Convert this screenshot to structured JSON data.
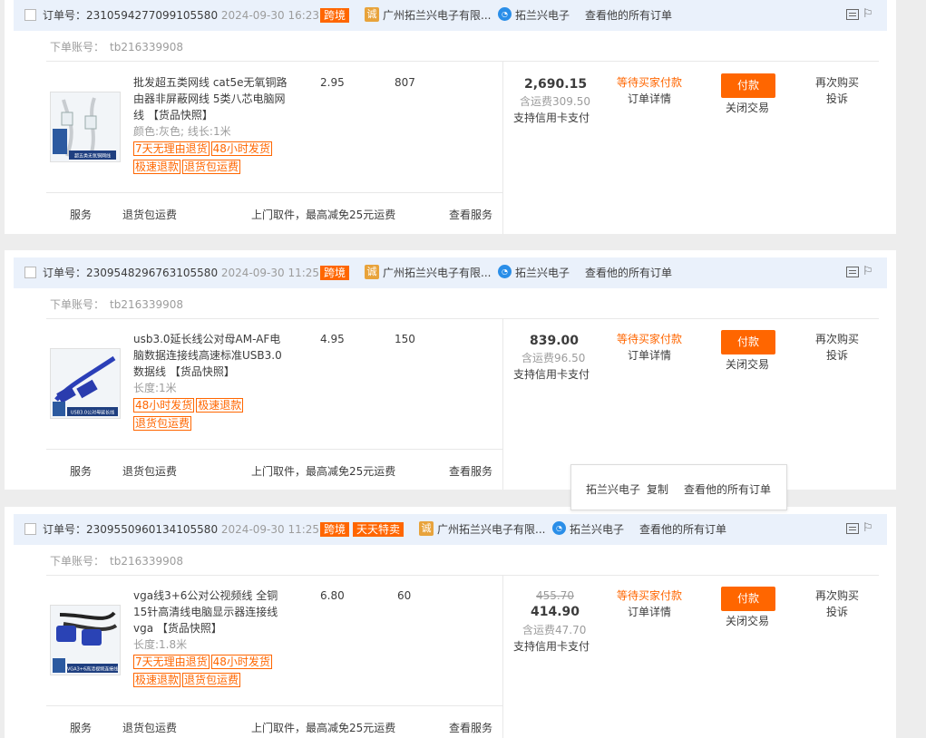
{
  "orders": [
    {
      "order_no_label": "订单号：",
      "order_no": "2310594277099105580",
      "time": "2024-09-30 16:23:52",
      "tags": [
        "跨境"
      ],
      "shop_name": "广州拓兰兴电子有限...",
      "seller": "拓兰兴电子",
      "view_all": "查看他的所有订单",
      "account_label": "下单账号：",
      "account": "tb216339908",
      "title": "批发超五类网线 cat5e无氧铜路由器非屏蔽网线 5类八芯电脑网线",
      "snapshot": "【货品快照】",
      "spec": "颜色:灰色;  线长:1米",
      "badges": [
        "7天无理由退货",
        "48小时发货",
        "极速退款",
        "退货包运费"
      ],
      "unit_price": "2.95",
      "quantity": "807",
      "original_price": "",
      "total": "2,690.15",
      "shipping": "含运费309.50",
      "credit": "支持信用卡支付",
      "status": "等待买家付款",
      "detail": "订单详情",
      "pay": "付款",
      "close": "关闭交易",
      "rebuy": "再次购买",
      "complain": "投诉",
      "svc_label": "服务",
      "svc_return": "退货包运费",
      "svc_pickup": "上门取件，最高减免25元运费",
      "svc_view": "查看服务",
      "thumb_text": "超五类无氧铜网线"
    },
    {
      "order_no_label": "订单号：",
      "order_no": "2309548296763105580",
      "time": "2024-09-30 11:25:09",
      "tags": [
        "跨境"
      ],
      "shop_name": "广州拓兰兴电子有限...",
      "seller": "拓兰兴电子",
      "view_all": "查看他的所有订单",
      "account_label": "下单账号：",
      "account": "tb216339908",
      "title": "usb3.0延长线公对母AM-AF电脑数据连接线高速标准USB3.0数据线",
      "snapshot": "【货品快照】",
      "spec": "长度:1米",
      "badges": [
        "48小时发货",
        "极速退款",
        "退货包运费"
      ],
      "unit_price": "4.95",
      "quantity": "150",
      "original_price": "",
      "total": "839.00",
      "shipping": "含运费96.50",
      "credit": "支持信用卡支付",
      "status": "等待买家付款",
      "detail": "订单详情",
      "pay": "付款",
      "close": "关闭交易",
      "rebuy": "再次购买",
      "complain": "投诉",
      "svc_label": "服务",
      "svc_return": "退货包运费",
      "svc_pickup": "上门取件，最高减免25元运费",
      "svc_view": "查看服务",
      "thumb_text": "USB3.0公对母延长线"
    },
    {
      "order_no_label": "订单号：",
      "order_no": "2309550960134105580",
      "time": "2024-09-30 11:25:09",
      "tags": [
        "跨境",
        "天天特卖"
      ],
      "shop_name": "广州拓兰兴电子有限...",
      "seller": "拓兰兴电子",
      "view_all": "查看他的所有订单",
      "account_label": "下单账号：",
      "account": "tb216339908",
      "title": "vga线3+6公对公视频线 全铜15针高清线电脑显示器连接线vga",
      "snapshot": "【货品快照】",
      "spec": "长度:1.8米",
      "badges": [
        "7天无理由退货",
        "48小时发货",
        "极速退款",
        "退货包运费"
      ],
      "unit_price": "6.80",
      "quantity": "60",
      "original_price": "455.70",
      "total": "414.90",
      "shipping": "含运费47.70",
      "credit": "支持信用卡支付",
      "status": "等待买家付款",
      "detail": "订单详情",
      "pay": "付款",
      "close": "关闭交易",
      "rebuy": "再次购买",
      "complain": "投诉",
      "svc_label": "服务",
      "svc_return": "退货包运费",
      "svc_pickup": "上门取件，最高减免25元运费",
      "svc_view": "查看服务",
      "thumb_text": "VGA3+6高清视频连接线"
    }
  ],
  "popup": {
    "seller": "拓兰兴电子",
    "copy": "复制",
    "view_all": "查看他的所有订单"
  },
  "icons": {
    "shop": "shop-cheng-icon",
    "wangwang": "wangwang-icon",
    "note": "note-icon",
    "flag": "flag-icon"
  },
  "colors": {
    "accent": "#ff6600",
    "header_bg": "#eaf1fb",
    "page_bg": "#ededed"
  }
}
